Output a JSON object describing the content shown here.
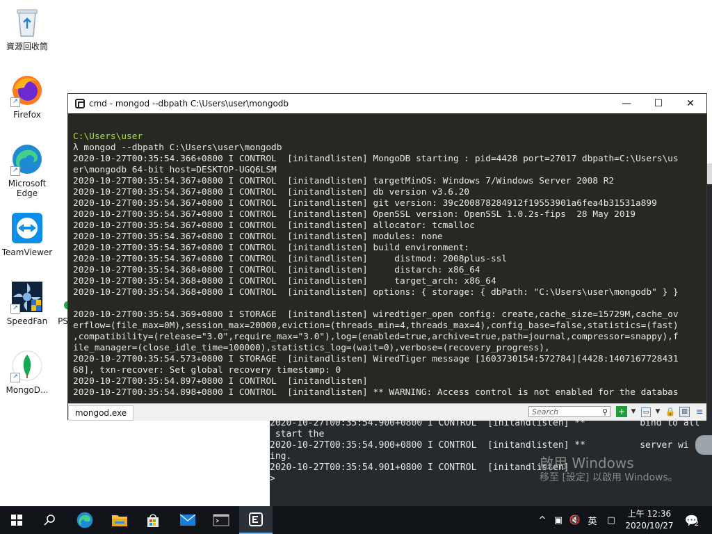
{
  "desktop": {
    "icons": [
      {
        "label": "資源回收筒"
      },
      {
        "label": "Firefox"
      },
      {
        "label": "Microsoft Edge"
      },
      {
        "label": "TeamViewer"
      },
      {
        "label": "SpeedFan"
      },
      {
        "label": "PS"
      },
      {
        "label": "MongoD..."
      }
    ],
    "watermark": {
      "line1": "啟用 Windows",
      "line2": "移至 [設定] 以啟用 Windows。"
    }
  },
  "background_console": {
    "lines": [
      "2020-10-27T00:35:54.900+0800 I CONTROL  [initandlisten] **          bind to all",
      " start the",
      "2020-10-27T00:35:54.900+0800 I CONTROL  [initandlisten] **          server wi",
      "ing.",
      "2020-10-27T00:35:54.901+0800 I CONTROL  [initandlisten]",
      ">"
    ]
  },
  "window": {
    "title": "cmd - mongod  --dbpath C:\\Users\\user\\mongodb",
    "controls": {
      "minimize": "—",
      "maximize": "☐",
      "close": "✕"
    },
    "console": {
      "prompt_path": "C:\\Users\\user",
      "command": "λ mongod --dbpath C:\\Users\\user\\mongodb",
      "lines": [
        "2020-10-27T00:35:54.366+0800 I CONTROL  [initandlisten] MongoDB starting : pid=4428 port=27017 dbpath=C:\\Users\\us",
        "er\\mongodb 64-bit host=DESKTOP-UGQ6LSM",
        "2020-10-27T00:35:54.367+0800 I CONTROL  [initandlisten] targetMinOS: Windows 7/Windows Server 2008 R2",
        "2020-10-27T00:35:54.367+0800 I CONTROL  [initandlisten] db version v3.6.20",
        "2020-10-27T00:35:54.367+0800 I CONTROL  [initandlisten] git version: 39c200878284912f19553901a6fea4b31531a899",
        "2020-10-27T00:35:54.367+0800 I CONTROL  [initandlisten] OpenSSL version: OpenSSL 1.0.2s-fips  28 May 2019",
        "2020-10-27T00:35:54.367+0800 I CONTROL  [initandlisten] allocator: tcmalloc",
        "2020-10-27T00:35:54.367+0800 I CONTROL  [initandlisten] modules: none",
        "2020-10-27T00:35:54.367+0800 I CONTROL  [initandlisten] build environment:",
        "2020-10-27T00:35:54.367+0800 I CONTROL  [initandlisten]     distmod: 2008plus-ssl",
        "2020-10-27T00:35:54.368+0800 I CONTROL  [initandlisten]     distarch: x86_64",
        "2020-10-27T00:35:54.368+0800 I CONTROL  [initandlisten]     target_arch: x86_64",
        "2020-10-27T00:35:54.368+0800 I CONTROL  [initandlisten] options: { storage: { dbPath: \"C:\\Users\\user\\mongodb\" } }",
        "",
        "2020-10-27T00:35:54.369+0800 I STORAGE  [initandlisten] wiredtiger_open config: create,cache_size=15729M,cache_ov",
        "erflow=(file_max=0M),session_max=20000,eviction=(threads_min=4,threads_max=4),config_base=false,statistics=(fast)",
        ",compatibility=(release=\"3.0\",require_max=\"3.0\"),log=(enabled=true,archive=true,path=journal,compressor=snappy),f",
        "ile_manager=(close_idle_time=100000),statistics_log=(wait=0),verbose=(recovery_progress),",
        "2020-10-27T00:35:54.573+0800 I STORAGE  [initandlisten] WiredTiger message [1603730154:572784][4428:1407167728431",
        "68], txn-recover: Set global recovery timestamp: 0",
        "2020-10-27T00:35:54.897+0800 I CONTROL  [initandlisten]",
        "2020-10-27T00:35:54.898+0800 I CONTROL  [initandlisten] ** WARNING: Access control is not enabled for the databas"
      ]
    },
    "tab_label": "mongod.exe",
    "search_placeholder": "Search"
  },
  "taskbar": {
    "clock_time": "上午 12:36",
    "clock_date": "2020/10/27",
    "ime": "英",
    "notification_count": "2"
  }
}
